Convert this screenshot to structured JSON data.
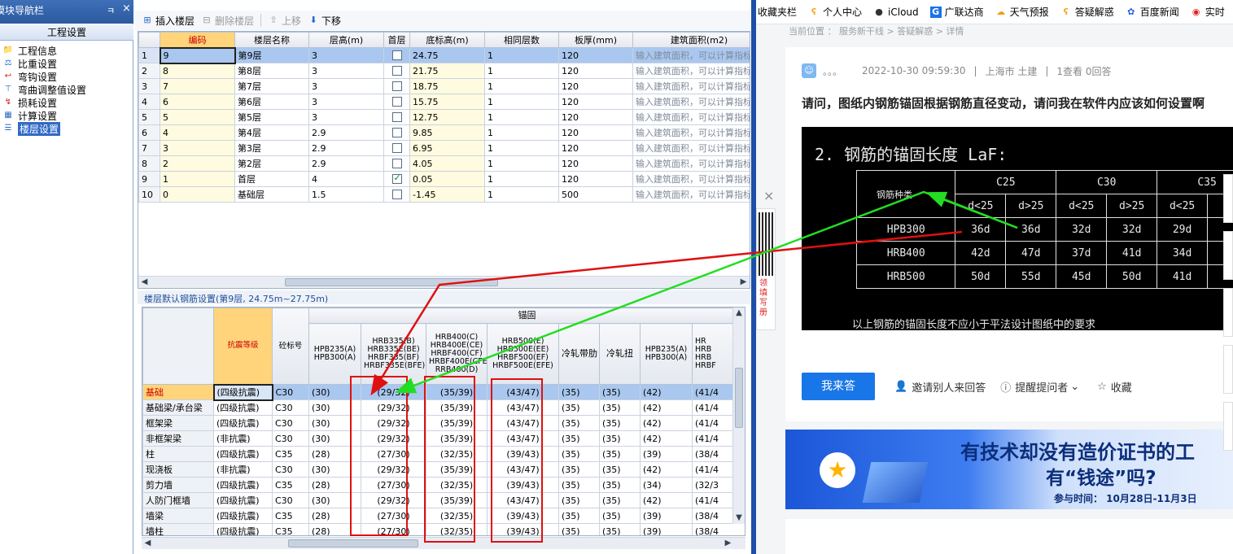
{
  "nav": {
    "title": "模块导航栏",
    "pin": "ㅋ",
    "close": "×",
    "group": "工程设置",
    "items": [
      {
        "label": "工程信息",
        "icon": "project-info-icon"
      },
      {
        "label": "比重设置",
        "icon": "density-icon"
      },
      {
        "label": "弯钩设置",
        "icon": "hook-icon"
      },
      {
        "label": "弯曲调整值设置",
        "icon": "bend-icon"
      },
      {
        "label": "损耗设置",
        "icon": "loss-icon"
      },
      {
        "label": "计算设置",
        "icon": "calc-icon"
      },
      {
        "label": "楼层设置",
        "icon": "floor-icon"
      }
    ]
  },
  "toolbar": {
    "insert": "插入楼层",
    "delete": "删除楼层",
    "up": "上移",
    "down": "下移"
  },
  "floors": {
    "headers": [
      "",
      "编码",
      "楼层名称",
      "层高(m)",
      "首层",
      "底标高(m)",
      "相同层数",
      "板厚(mm)",
      "建筑面积(m2)"
    ],
    "area_placeholder": "输入建筑面积，可以计算指标",
    "rows": [
      {
        "n": "1",
        "code": "9",
        "name": "第9层",
        "h": "3",
        "first": false,
        "elev": "24.75",
        "same": "1",
        "thick": "120"
      },
      {
        "n": "2",
        "code": "8",
        "name": "第8层",
        "h": "3",
        "first": false,
        "elev": "21.75",
        "same": "1",
        "thick": "120"
      },
      {
        "n": "3",
        "code": "7",
        "name": "第7层",
        "h": "3",
        "first": false,
        "elev": "18.75",
        "same": "1",
        "thick": "120"
      },
      {
        "n": "4",
        "code": "6",
        "name": "第6层",
        "h": "3",
        "first": false,
        "elev": "15.75",
        "same": "1",
        "thick": "120"
      },
      {
        "n": "5",
        "code": "5",
        "name": "第5层",
        "h": "3",
        "first": false,
        "elev": "12.75",
        "same": "1",
        "thick": "120"
      },
      {
        "n": "6",
        "code": "4",
        "name": "第4层",
        "h": "2.9",
        "first": false,
        "elev": "9.85",
        "same": "1",
        "thick": "120"
      },
      {
        "n": "7",
        "code": "3",
        "name": "第3层",
        "h": "2.9",
        "first": false,
        "elev": "6.95",
        "same": "1",
        "thick": "120"
      },
      {
        "n": "8",
        "code": "2",
        "name": "第2层",
        "h": "2.9",
        "first": false,
        "elev": "4.05",
        "same": "1",
        "thick": "120"
      },
      {
        "n": "9",
        "code": "1",
        "name": "首层",
        "h": "4",
        "first": true,
        "elev": "0.05",
        "same": "1",
        "thick": "120"
      },
      {
        "n": "10",
        "code": "0",
        "name": "基础层",
        "h": "1.5",
        "first": false,
        "elev": "-1.45",
        "same": "1",
        "thick": "500"
      }
    ]
  },
  "rebar": {
    "section_title": "楼层默认钢筋设置(第9层, 24.75m~27.75m)",
    "group_anchor": "锚固",
    "col_seismic": "抗震等级",
    "col_concrete": "砼标号",
    "col_hpb": "HPB235(A)\nHPB300(A)",
    "col_hrb335": "HRB335(B)\nHRB335E(BE)\nHRBF335(BF)\nHRBF335E(BFE)",
    "col_hrb400": "HRB400(C)\nHRB400E(CE)\nHRBF400(CF)\nHRBF400E(CFE)\nRRB400(D)",
    "col_hrb500": "HRB500(E)\nHRB500E(EE)\nHRBF500(EF)\nHRBF500E(EFE)",
    "col_cold_ribbed": "冷轧带肋",
    "col_cold_twisted": "冷轧扭",
    "col_hpb2": "HPB235(A)\nHPB300(A)",
    "col_trunc": "HR\nHRB\nHRB\nHRBF",
    "rows": [
      {
        "cat": "基础",
        "sei": "(四级抗震)",
        "conc": "C30",
        "a": "(30)",
        "b": "(29/32)",
        "c": "(35/39)",
        "d": "(43/47)",
        "e": "(35)",
        "f": "(35)",
        "g": "(42)",
        "h": "(41/4"
      },
      {
        "cat": "基础梁/承台梁",
        "sei": "(四级抗震)",
        "conc": "C30",
        "a": "(30)",
        "b": "(29/32)",
        "c": "(35/39)",
        "d": "(43/47)",
        "e": "(35)",
        "f": "(35)",
        "g": "(42)",
        "h": "(41/4"
      },
      {
        "cat": "框架梁",
        "sei": "(四级抗震)",
        "conc": "C30",
        "a": "(30)",
        "b": "(29/32)",
        "c": "(35/39)",
        "d": "(43/47)",
        "e": "(35)",
        "f": "(35)",
        "g": "(42)",
        "h": "(41/4"
      },
      {
        "cat": "非框架梁",
        "sei": "(非抗震)",
        "conc": "C30",
        "a": "(30)",
        "b": "(29/32)",
        "c": "(35/39)",
        "d": "(43/47)",
        "e": "(35)",
        "f": "(35)",
        "g": "(42)",
        "h": "(41/4"
      },
      {
        "cat": "柱",
        "sei": "(四级抗震)",
        "conc": "C35",
        "a": "(28)",
        "b": "(27/30)",
        "c": "(32/35)",
        "d": "(39/43)",
        "e": "(35)",
        "f": "(35)",
        "g": "(39)",
        "h": "(38/4"
      },
      {
        "cat": "现浇板",
        "sei": "(非抗震)",
        "conc": "C30",
        "a": "(30)",
        "b": "(29/32)",
        "c": "(35/39)",
        "d": "(43/47)",
        "e": "(35)",
        "f": "(35)",
        "g": "(42)",
        "h": "(41/4"
      },
      {
        "cat": "剪力墙",
        "sei": "(四级抗震)",
        "conc": "C35",
        "a": "(28)",
        "b": "(27/30)",
        "c": "(32/35)",
        "d": "(39/43)",
        "e": "(35)",
        "f": "(35)",
        "g": "(34)",
        "h": "(32/3"
      },
      {
        "cat": "人防门框墙",
        "sei": "(四级抗震)",
        "conc": "C30",
        "a": "(30)",
        "b": "(29/32)",
        "c": "(35/39)",
        "d": "(43/47)",
        "e": "(35)",
        "f": "(35)",
        "g": "(42)",
        "h": "(41/4"
      },
      {
        "cat": "墙梁",
        "sei": "(四级抗震)",
        "conc": "C35",
        "a": "(28)",
        "b": "(27/30)",
        "c": "(32/35)",
        "d": "(39/43)",
        "e": "(35)",
        "f": "(35)",
        "g": "(39)",
        "h": "(38/4"
      },
      {
        "cat": "墙柱",
        "sei": "(四级抗震)",
        "conc": "C35",
        "a": "(28)",
        "b": "(27/30)",
        "c": "(32/35)",
        "d": "(39/43)",
        "e": "(35)",
        "f": "(35)",
        "g": "(39)",
        "h": "(38/4"
      }
    ]
  },
  "browser": {
    "bookmarks": [
      {
        "label": "收藏夹栏",
        "icon": ""
      },
      {
        "label": "个人中心",
        "icon": "answer-logo-icon"
      },
      {
        "label": "iCloud",
        "icon": "apple-icon"
      },
      {
        "label": "广联达商",
        "icon": "glodon-icon"
      },
      {
        "label": "天气预报",
        "icon": "weather-icon"
      },
      {
        "label": "答疑解惑",
        "icon": "answer-logo-icon"
      },
      {
        "label": "百度新闻",
        "icon": "baidu-icon"
      },
      {
        "label": "实时",
        "icon": "weibo-icon"
      }
    ],
    "crumb": "当前位置 ： 服务新干线 > 答疑解惑 > 详情",
    "author": "。。。",
    "datetime": "2022-10-30 09:59:30",
    "location": "上海市  土建",
    "stats": "1查看  0回答",
    "question": "请问，图纸内钢筋锚固根据钢筋直径变动，请问我在软件内应该如何设置啊",
    "image": {
      "heading": "2. 钢筋的锚固长度 LaF:",
      "grades": [
        "C25",
        "C30",
        "C35"
      ],
      "type_label": "钢筋种类",
      "subcols": [
        "d<25",
        "d>25",
        "d<25",
        "d>25",
        "d<25"
      ],
      "rows": [
        {
          "type": "HPB300",
          "vals": [
            "36d",
            "36d",
            "32d",
            "32d",
            "29d"
          ]
        },
        {
          "type": "HRB400",
          "vals": [
            "42d",
            "47d",
            "37d",
            "41d",
            "34d"
          ]
        },
        {
          "type": "HRB500",
          "vals": [
            "50d",
            "55d",
            "45d",
            "50d",
            "41d"
          ]
        }
      ],
      "footnote": "以上钢筋的锚固长度不应小于平法设计图纸中的要求"
    },
    "answer_btn": "我来答",
    "invite": "邀请别人来回答",
    "remind": "提醒提问者",
    "favorite": "收藏",
    "qr_text": "领填写册",
    "qr_close": "×",
    "banner1": "有技术却没有造价证书的工",
    "banner2": "有“钱途”吗?",
    "banner3": "参与时间： 10月28日-11月3日"
  },
  "colors": {
    "annotation_red": "#e01010",
    "annotation_green": "#22dd22",
    "accent_blue": "#1976e8"
  }
}
